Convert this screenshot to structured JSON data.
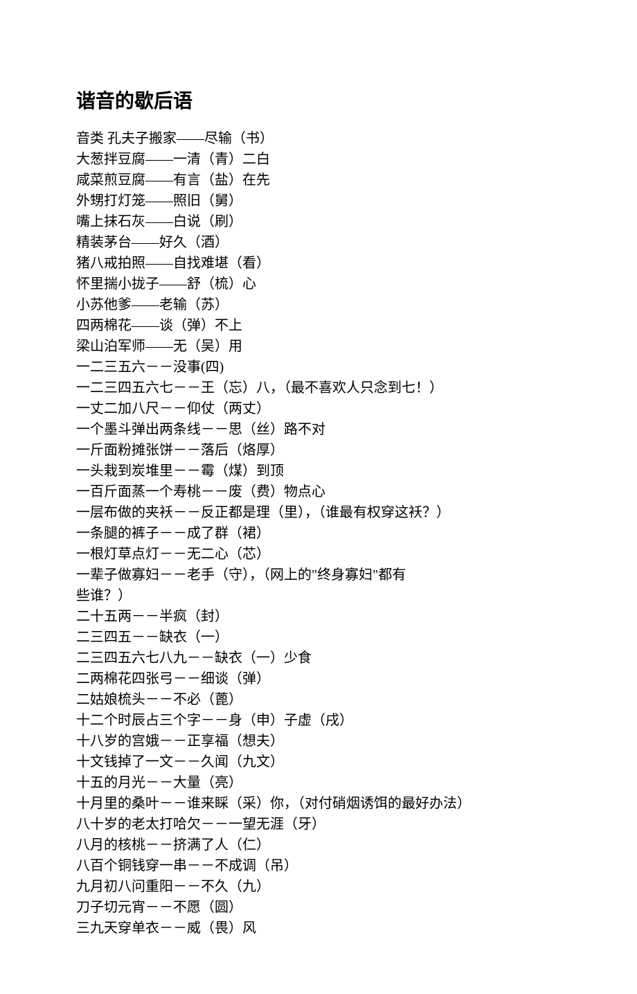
{
  "title": "谐音的歇后语",
  "lines": [
    "音类 孔夫子搬家——尽输（书）",
    "大葱拌豆腐——一清（青）二白",
    "咸菜煎豆腐——有言（盐）在先",
    "外甥打灯笼——照旧（舅）",
    "嘴上抹石灰——白说（刷）",
    "精装茅台——好久（酒）",
    "猪八戒拍照——自找难堪（看）",
    "怀里揣小拢子——舒（梳）心",
    "小苏他爹——老输（苏）",
    "四两棉花——谈（弹）不上",
    "梁山泊军师——无（吴）用",
    "一二三五六－－没事(四)",
    "一二三四五六七－－王（忘）八，（最不喜欢人只念到七！）",
    "一丈二加八尺－－仰仗（两丈）",
    "一个墨斗弹出两条线－－思（丝）路不对",
    "一斤面粉摊张饼－－落后（烙厚）",
    "一头栽到炭堆里－－霉（煤）到顶",
    "一百斤面蒸一个寿桃－－废（费）物点心",
    "一层布做的夹袄－－反正都是理（里），（谁最有权穿这袄？）",
    "一条腿的裤子－－成了群（裙）",
    "一根灯草点灯－－无二心（芯）",
    "一辈子做寡妇－－老手（守），（网上的\"终身寡妇\"都有",
    "些谁？）",
    "二十五两－－半疯（封）",
    "二三四五－－缺衣（一）",
    "二三四五六七八九－－缺衣（一）少食",
    "二两棉花四张弓－－细谈（弹）",
    "二姑娘梳头－－不必（蓖）",
    "十二个时辰占三个字－－身（申）子虚（戌）",
    "十八岁的宫娥－－正享福（想夫）",
    "十文钱掉了一文－－久闻（九文）",
    "十五的月光－－大量（亮）",
    "十月里的桑叶－－谁来睬（采）你，（对付硝烟诱饵的最好办法）",
    "八十岁的老太打哈欠－－一望无涯（牙）",
    "八月的核桃－－挤满了人（仁）",
    "八百个铜钱穿一串－－不成调（吊）",
    "九月初八问重阳－－不久（九）",
    "刀子切元宵－－不愿（圆）",
    "三九天穿单衣－－威（畏）风"
  ]
}
